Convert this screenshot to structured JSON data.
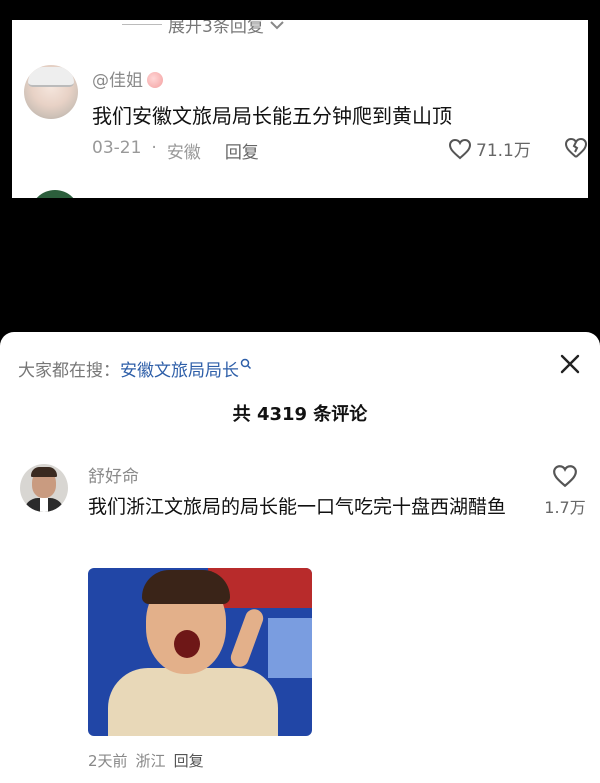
{
  "top_comment": {
    "expand_text": "展开3条回复",
    "username": "@佳姐",
    "text": "我们安徽文旅局局长能五分钟爬到黄山顶",
    "date": "03-21",
    "location": "安徽",
    "reply_label": "回复",
    "likes": "71.1万"
  },
  "sheet": {
    "search_prefix": "大家都在搜：",
    "search_term": "安徽文旅局局长",
    "comment_count": "共 4319 条评论"
  },
  "comment": {
    "username": "舒好命",
    "text": "我们浙江文旅局的局长能一口气吃完十盘西湖醋鱼",
    "likes": "1.7万",
    "time": "2天前",
    "location": "浙江",
    "reply_label": "回复"
  },
  "colors": {
    "link_blue": "#2d5ea8",
    "muted": "#8a8a8a"
  },
  "icons": [
    "heart-icon",
    "broken-heart-icon",
    "close-icon",
    "search-icon",
    "chevron-down-icon"
  ]
}
